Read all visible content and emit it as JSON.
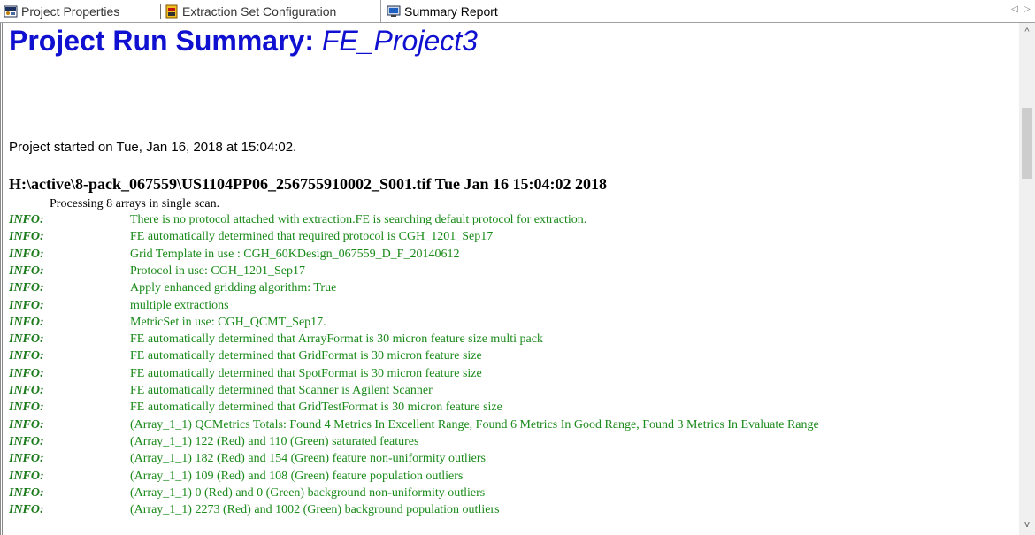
{
  "tabs": [
    {
      "label": "Project Properties",
      "icon": "project-properties-icon"
    },
    {
      "label": "Extraction Set Configuration",
      "icon": "extraction-set-icon"
    },
    {
      "label": "Summary Report",
      "icon": "summary-report-icon",
      "active": true
    }
  ],
  "tab_nav": {
    "left": "◁",
    "right": "▷"
  },
  "report": {
    "title_prefix": "Project Run Summary: ",
    "project_name": "FE_Project3",
    "started": "Project started on Tue, Jan 16, 2018 at 15:04:02.",
    "file_header": "H:\\active\\8-pack_067559\\US1104PP06_256755910002_S001.tif Tue Jan 16 15:04:02 2018",
    "processing": "Processing 8 arrays in single scan.",
    "log": [
      {
        "level": "INFO:",
        "message": "There is no protocol attached with extraction.FE is searching default protocol for extraction."
      },
      {
        "level": "INFO:",
        "message": "FE automatically determined that required protocol is CGH_1201_Sep17"
      },
      {
        "level": "INFO:",
        "message": "Grid Template in use : CGH_60KDesign_067559_D_F_20140612"
      },
      {
        "level": "INFO:",
        "message": "Protocol in use: CGH_1201_Sep17"
      },
      {
        "level": "INFO:",
        "message": "Apply enhanced gridding algorithm: True"
      },
      {
        "level": "INFO:",
        "message": "multiple extractions"
      },
      {
        "level": "INFO:",
        "message": "MetricSet in use: CGH_QCMT_Sep17."
      },
      {
        "level": "INFO:",
        "message": "FE automatically determined that ArrayFormat is 30 micron feature size multi pack"
      },
      {
        "level": "INFO:",
        "message": "FE automatically determined that GridFormat is 30 micron feature size"
      },
      {
        "level": "INFO:",
        "message": "FE automatically determined that SpotFormat is 30 micron feature size"
      },
      {
        "level": "INFO:",
        "message": "FE automatically determined that Scanner is Agilent Scanner"
      },
      {
        "level": "INFO:",
        "message": "FE automatically determined that GridTestFormat is 30 micron feature size"
      },
      {
        "level": "INFO:",
        "message": "(Array_1_1) QCMetrics Totals:  Found 4 Metrics In Excellent Range, Found 6 Metrics In Good Range, Found 3 Metrics In Evaluate Range"
      },
      {
        "level": "INFO:",
        "message": "(Array_1_1) 122 (Red) and 110 (Green) saturated features"
      },
      {
        "level": "INFO:",
        "message": "(Array_1_1) 182 (Red) and 154 (Green) feature non-uniformity outliers"
      },
      {
        "level": "INFO:",
        "message": "(Array_1_1) 109 (Red) and 108 (Green) feature population outliers"
      },
      {
        "level": "INFO:",
        "message": "(Array_1_1) 0 (Red) and 0 (Green) background non-uniformity outliers"
      },
      {
        "level": "INFO:",
        "message": "(Array_1_1) 2273 (Red) and 1002 (Green) background population outliers"
      }
    ]
  },
  "scroll": {
    "up": "^",
    "down": "v"
  },
  "colors": {
    "title": "#1010d0",
    "info": "#1a7a1a"
  }
}
